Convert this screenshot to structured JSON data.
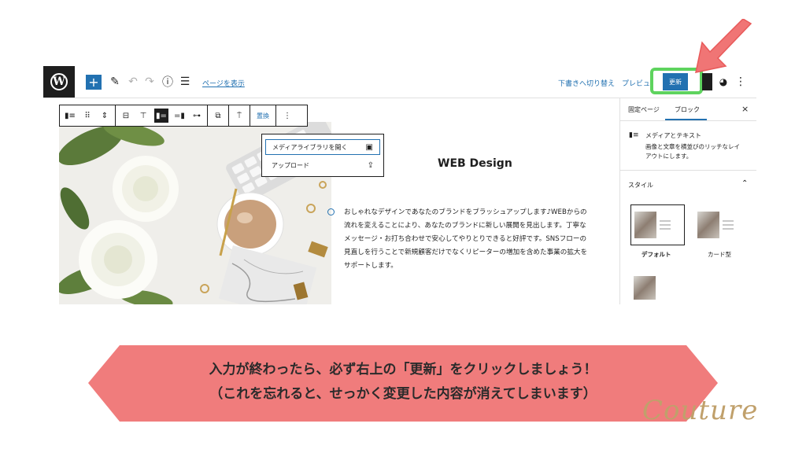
{
  "topbar": {
    "add_icon": "plus",
    "view_page_link": "ページを表示",
    "switch_to_draft": "下書きへ切り替え",
    "preview": "プレビュ",
    "update_button": "更新"
  },
  "block_toolbar": {
    "replace_label": "置換"
  },
  "media_popover": {
    "items": [
      {
        "label": "メディアライブラリを開く",
        "icon": "media-library-icon"
      },
      {
        "label": "アップロード",
        "icon": "upload-icon"
      }
    ]
  },
  "content": {
    "heading": "WEB Design",
    "paragraph_lines": [
      "おしゃれなデザインであなたのブランドをブラッシュアップします♪WEBからの",
      "流れを変えることにより、あなたのブランドに新しい展開を見出します。丁寧な",
      "メッセージ・お打ち合わせで安心してやりとりできると好評です。SNSフローの",
      "見直しを行うことで新規顧客だけでなくリピーターの増加を含めた事業の拡大を",
      "サポートします。"
    ]
  },
  "sidebar": {
    "tabs": [
      "固定ページ",
      "ブロック"
    ],
    "close": "×",
    "block_title": "メディアとテキスト",
    "block_desc_lines": [
      "画像と文章を横並びのリッチなレイ",
      "アウトにします。"
    ],
    "style_section": "スタイル",
    "styles": [
      "デフォルト",
      "カード型"
    ]
  },
  "banner": {
    "line1": "入力が終わったら、必ず右上の「更新」をクリックしましょう！",
    "line2": "（これを忘れると、せっかく変更した内容が消えてしまいます）"
  },
  "brand": "Couture",
  "colors": {
    "accent_blue": "#2271b1",
    "highlight_green": "#5ed35e",
    "arrow_pink": "#f07575",
    "banner_pink": "#f07c7c",
    "brand_gold": "#c0a06b"
  }
}
